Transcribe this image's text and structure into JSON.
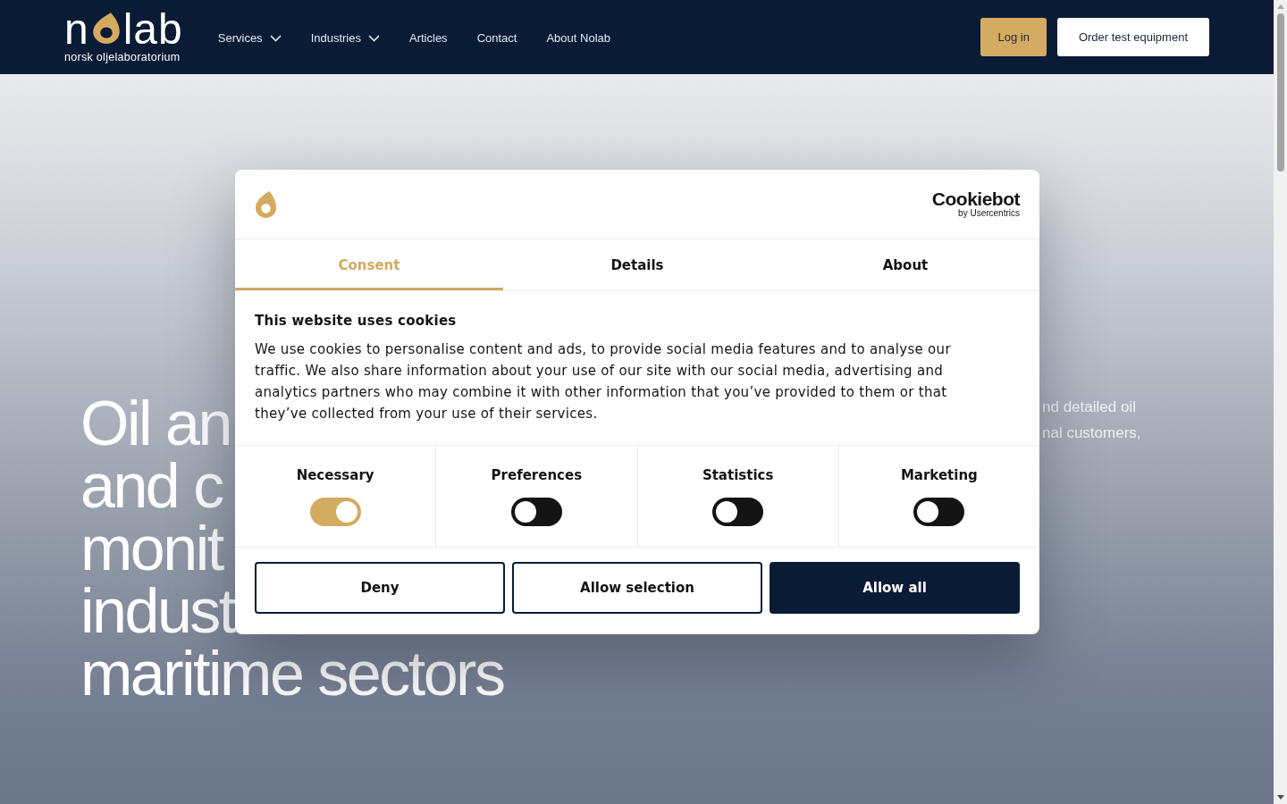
{
  "header": {
    "logo": {
      "wordmark_start": "n",
      "wordmark_end": "lab",
      "tagline": "norsk oljelaboratorium"
    },
    "nav": [
      {
        "label": "Services",
        "dropdown": true
      },
      {
        "label": "Industries",
        "dropdown": true
      },
      {
        "label": "Articles",
        "dropdown": false
      },
      {
        "label": "Contact",
        "dropdown": false
      },
      {
        "label": "About Nolab",
        "dropdown": false
      }
    ],
    "buttons": [
      {
        "label": "Log in",
        "kind": "primary"
      },
      {
        "label": "Order test equipment",
        "kind": "secondary"
      }
    ]
  },
  "hero": {
    "title_lines": [
      "Oil an",
      "and c",
      "monit",
      "indust",
      "maritime sectors"
    ],
    "intro_lines": [
      "nd detailed oil",
      "nal customers,"
    ]
  },
  "cookie_dialog": {
    "brand": {
      "name": "Cookiebot",
      "byline": "by Usercentrics"
    },
    "tabs": [
      {
        "label": "Consent",
        "selected": true
      },
      {
        "label": "Details",
        "selected": false
      },
      {
        "label": "About",
        "selected": false
      }
    ],
    "heading": "This website uses cookies",
    "text": "We use cookies to personalise content and ads, to provide social media features and to analyse our traffic. We also share information about your use of our site with our social media, advertising and analytics partners who may combine it with other information that you’ve provided to them or that they’ve collected from your use of their services.",
    "categories": [
      {
        "label": "Necessary",
        "checked": true
      },
      {
        "label": "Preferences",
        "checked": false
      },
      {
        "label": "Statistics",
        "checked": false
      },
      {
        "label": "Marketing",
        "checked": false
      }
    ],
    "buttons": [
      {
        "label": "Deny",
        "kind": "outline"
      },
      {
        "label": "Allow selection",
        "kind": "outline"
      },
      {
        "label": "Allow all",
        "kind": "filled"
      }
    ]
  }
}
